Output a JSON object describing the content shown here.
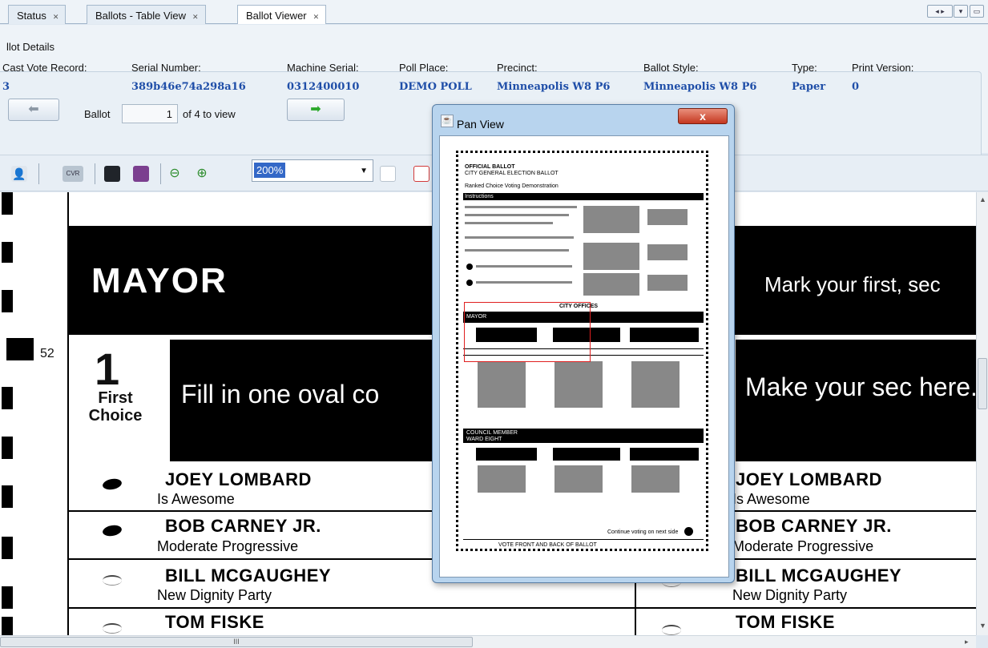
{
  "tabs": [
    {
      "label": "Status",
      "active": false
    },
    {
      "label": "Ballots - Table View",
      "active": false
    },
    {
      "label": "Ballot Viewer",
      "active": true
    }
  ],
  "details": {
    "section_title": "llot Details",
    "fields": [
      {
        "label": "Cast Vote Record:",
        "value": "3"
      },
      {
        "label": "Serial Number:",
        "value": "389b46e74a298a16"
      },
      {
        "label": "Machine Serial:",
        "value": "0312400010"
      },
      {
        "label": "Poll Place:",
        "value": "DEMO POLL"
      },
      {
        "label": "Precinct:",
        "value": "Minneapolis W8 P6"
      },
      {
        "label": "Ballot Style:",
        "value": "Minneapolis W8 P6"
      },
      {
        "label": "Type:",
        "value": "Paper"
      },
      {
        "label": "Print Version:",
        "value": "0"
      }
    ],
    "nav": {
      "ballot_label": "Ballot",
      "current": "1",
      "total_text": "of 4 to view"
    }
  },
  "toolbar": {
    "zoom_value": "200%",
    "icons": [
      "user-icon",
      "cvr-icon",
      "save-icon",
      "print-icon",
      "zoom-out-icon",
      "zoom-in-icon",
      "page-icon",
      "page-red-icon"
    ]
  },
  "ballot": {
    "line_number": "52",
    "contest_title": "MAYOR",
    "instruction_right": "Mark your first, sec",
    "first_choice": {
      "number": "1",
      "label": "First Choice",
      "instruction": "Fill in one oval co"
    },
    "second_choice_instruction": "Make your sec here.",
    "candidates": [
      {
        "name": "JOEY LOMBARD",
        "party": "Is Awesome",
        "first_marked": true
      },
      {
        "name": "BOB CARNEY JR.",
        "party": "Moderate Progressive",
        "first_marked": true
      },
      {
        "name": "BILL MCGAUGHEY",
        "party": "New Dignity Party",
        "first_marked": false
      },
      {
        "name": "TOM FISKE",
        "party": "",
        "first_marked": false
      }
    ]
  },
  "pan_view": {
    "title": "Pan View",
    "close_label": "x",
    "mini": {
      "official": "OFFICIAL BALLOT",
      "election": "CITY GENERAL ELECTION BALLOT",
      "demo": "Ranked Choice Voting Demonstration",
      "instructions": "Instructions",
      "city_offices": "CITY OFFICES",
      "mayor": "MAYOR",
      "council": "COUNCIL MEMBER WARD EIGHT",
      "continue": "Continue voting on next side",
      "footer": "VOTE FRONT AND BACK OF BALLOT"
    }
  },
  "scrollbar": {
    "h_grip": "III"
  }
}
